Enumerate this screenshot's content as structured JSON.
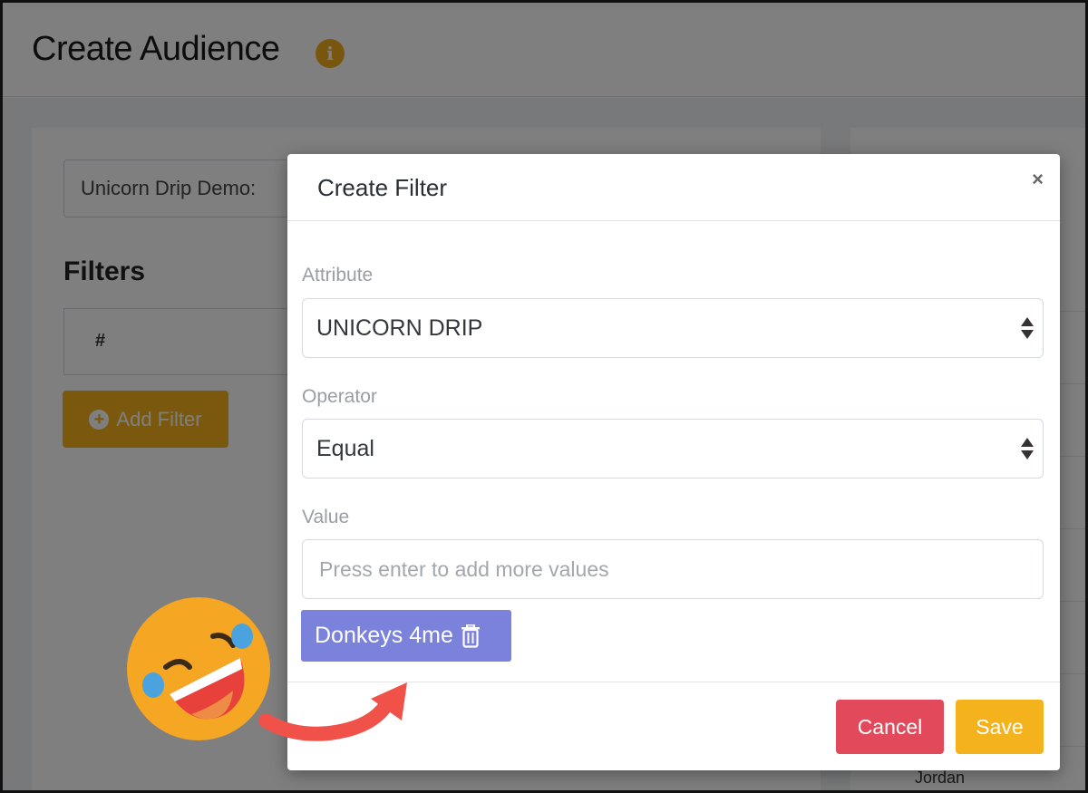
{
  "page": {
    "title": "Create Audience",
    "list_select_value": "Unicorn Drip Demo:",
    "filters_heading": "Filters",
    "filters_table_header": "#",
    "add_filter_label": "Add Filter",
    "background_row_name": "Jordan"
  },
  "modal": {
    "title": "Create Filter",
    "close_symbol": "×",
    "attribute_label": "Attribute",
    "attribute_value": "UNICORN DRIP",
    "operator_label": "Operator",
    "operator_value": "Equal",
    "value_label": "Value",
    "value_placeholder": "Press enter to add more values",
    "tags": [
      "Donkeys 4me"
    ],
    "cancel_label": "Cancel",
    "save_label": "Save"
  },
  "colors": {
    "accent_yellow": "#f4b21d",
    "cancel_red": "#e24a5c",
    "tag_purple": "#7b82dc",
    "arrow_red": "#f0524a"
  },
  "icons": [
    "info-icon",
    "plus-circle-icon",
    "close-icon",
    "select-arrows-icon",
    "trash-icon",
    "laughing-emoji-icon",
    "curved-arrow-icon"
  ]
}
